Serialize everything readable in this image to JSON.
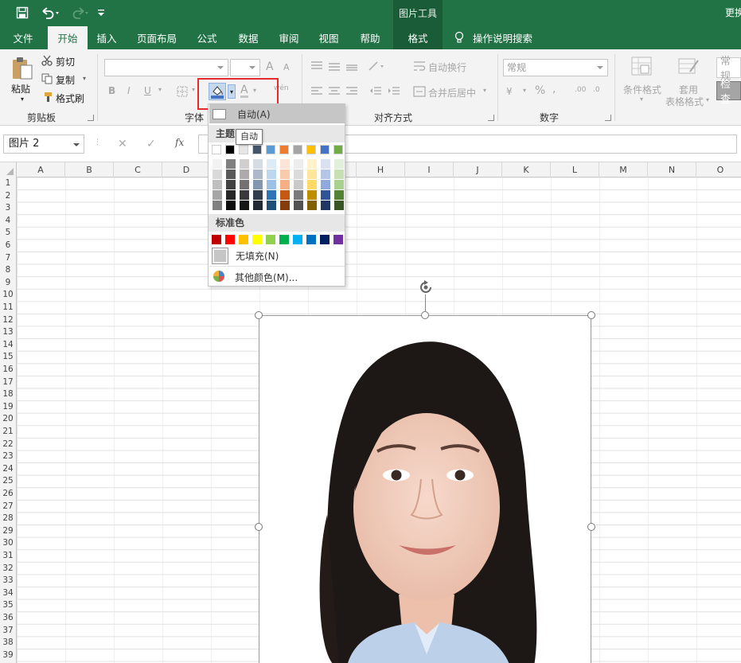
{
  "titlebar": {
    "context_tools_label": "图片工具",
    "right_label": "更换"
  },
  "tabs": [
    {
      "label": "文件"
    },
    {
      "label": "开始"
    },
    {
      "label": "插入"
    },
    {
      "label": "页面布局"
    },
    {
      "label": "公式"
    },
    {
      "label": "数据"
    },
    {
      "label": "审阅"
    },
    {
      "label": "视图"
    },
    {
      "label": "帮助"
    },
    {
      "label": "格式"
    }
  ],
  "tell_me": "操作说明搜索",
  "ribbon": {
    "clipboard": {
      "paste": "粘贴",
      "cut": "剪切",
      "copy": "复制",
      "format_painter": "格式刷",
      "group_label": "剪贴板"
    },
    "font": {
      "bold": "B",
      "italic": "I",
      "underline": "U",
      "font_color_letter": "A",
      "grow": "A",
      "shrink": "A",
      "phonetic_letter": "wén",
      "group_label": "字体"
    },
    "alignment": {
      "wrap_text": "自动换行",
      "merge_center": "合并后居中",
      "group_label": "对齐方式"
    },
    "number": {
      "format_value": "常规",
      "percent": "%",
      "comma": ",",
      "increase_decimal": ".00",
      "decrease_decimal": ".0",
      "currency_symbol": "¥",
      "group_label": "数字"
    },
    "styles": {
      "conditional": "条件格式",
      "table_format_1": "套用",
      "table_format_2": "表格格式",
      "style_normal": "常规",
      "style_check": "检查"
    }
  },
  "formula_bar": {
    "name_box": "图片 2",
    "fx": "fx",
    "cancel": "✕",
    "enter": "✓"
  },
  "columns": [
    "A",
    "B",
    "C",
    "D",
    "E",
    "F",
    "G",
    "H",
    "I",
    "J",
    "K",
    "L",
    "M",
    "N",
    "O"
  ],
  "rows": [
    "1",
    "2",
    "3",
    "4",
    "5",
    "6",
    "7",
    "8",
    "9",
    "10",
    "11",
    "12",
    "13",
    "14",
    "15",
    "16",
    "17",
    "18",
    "19",
    "20",
    "21",
    "22",
    "23",
    "24",
    "25",
    "26",
    "27",
    "28",
    "29",
    "30",
    "31",
    "32",
    "33",
    "34",
    "35",
    "36",
    "37",
    "38",
    "39"
  ],
  "color_menu": {
    "auto": "自动(A)",
    "theme_title": "主题",
    "standard_title": "标准色",
    "no_fill": "无填充(N)",
    "more_colors": "其他颜色(M)...",
    "tooltip": "自动",
    "theme_colors": [
      "#ffffff",
      "#000000",
      "#e7e6e6",
      "#44546a",
      "#5b9bd5",
      "#ed7d31",
      "#a5a5a5",
      "#ffc000",
      "#4472c4",
      "#70ad47"
    ],
    "theme_shades": [
      [
        "#f2f2f2",
        "#d9d9d9",
        "#bfbfbf",
        "#a6a6a6",
        "#808080"
      ],
      [
        "#808080",
        "#595959",
        "#404040",
        "#262626",
        "#0d0d0d"
      ],
      [
        "#d0cece",
        "#aeaaaa",
        "#757171",
        "#3a3838",
        "#171616"
      ],
      [
        "#d6dce4",
        "#adb9ca",
        "#8497b0",
        "#333f4f",
        "#222a35"
      ],
      [
        "#ddebf7",
        "#bdd7ee",
        "#9bc2e6",
        "#2f75b5",
        "#1f4e78"
      ],
      [
        "#fce4d6",
        "#f8cbad",
        "#f4b084",
        "#c65911",
        "#833c0b"
      ],
      [
        "#ededed",
        "#dbdbdb",
        "#c9c9c9",
        "#7b7b7b",
        "#525252"
      ],
      [
        "#fff2cc",
        "#ffe699",
        "#ffd966",
        "#bf8f00",
        "#806000"
      ],
      [
        "#d9e1f2",
        "#b4c6e7",
        "#8ea9db",
        "#305496",
        "#203764"
      ],
      [
        "#e2efda",
        "#c6e0b4",
        "#a9d08e",
        "#548235",
        "#375623"
      ]
    ],
    "standard_colors": [
      "#c00000",
      "#ff0000",
      "#ffc000",
      "#ffff00",
      "#92d050",
      "#00b050",
      "#00b0f0",
      "#0070c0",
      "#002060",
      "#7030a0"
    ]
  },
  "accent": {
    "excel_green": "#217346",
    "highlight_red": "#e52b2b",
    "fill_bar": "#4472c4"
  }
}
